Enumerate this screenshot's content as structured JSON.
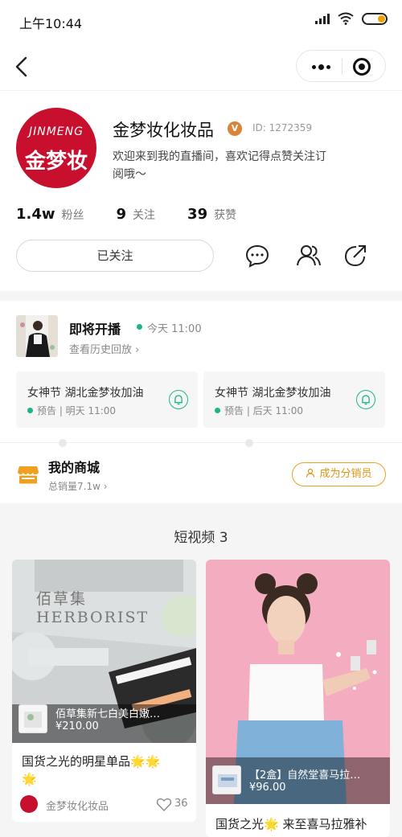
{
  "status_bar": {
    "time": "上午10:44"
  },
  "profile": {
    "avatar_text_top": "JINMENG",
    "avatar_text_main": "金梦妆",
    "name": "金梦妆化妆品",
    "badge": "V",
    "id_text": "ID: 1272359",
    "desc_line1": "欢迎来到我的直播间，喜欢记得点赞关注订",
    "desc_line2": "阅哦～",
    "stats": [
      {
        "num": "1.4w",
        "label": "粉丝"
      },
      {
        "num": "9",
        "label": "关注"
      },
      {
        "num": "39",
        "label": "获赞"
      }
    ],
    "follow_button": "已关注"
  },
  "live": {
    "title": "即将开播",
    "time": "今天 11:00",
    "history": "查看历史回放 ›",
    "notices": [
      {
        "title": "女神节 湖北金梦妆加油",
        "sub": "预告 | 明天 11:00"
      },
      {
        "title": "女神节 湖北金梦妆加油",
        "sub": "预告 | 后天 11:00"
      }
    ]
  },
  "store": {
    "title": "我的商城",
    "sales": "总销量7.1w ›",
    "distributor_button": "成为分销员"
  },
  "videos": {
    "heading": "短视频 3",
    "items": [
      {
        "product_name": "佰草集新七白美白嫩…",
        "price": "¥210.00",
        "title_line1": "国货之光的明星单品🌟🌟",
        "title_line2": "🌟",
        "author": "金梦妆化妆品",
        "likes": "36",
        "image_label": "佰草集 HERBORIST"
      },
      {
        "product_name": "【2盒】自然堂喜马拉…",
        "price": "¥96.00",
        "title_line1": "国货之光🌟 来至喜马拉雅补",
        "title_line2": ""
      }
    ]
  },
  "colors": {
    "accent_green": "#1cb58b",
    "accent_orange": "#f0a020",
    "brand_red": "#c8102e"
  }
}
